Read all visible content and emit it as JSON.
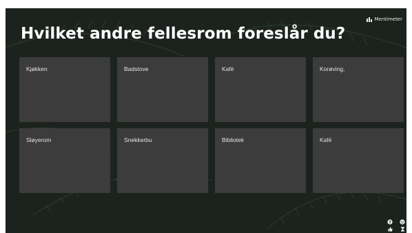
{
  "brand": {
    "name": "Mentimeter",
    "icon": "mentimeter-logo-icon"
  },
  "question": {
    "title": "Hvilket andre fellesrom foreslår du?"
  },
  "responses": [
    {
      "text": "Kjøkken"
    },
    {
      "text": "Badstove"
    },
    {
      "text": "Kafè"
    },
    {
      "text": "Korøving,"
    },
    {
      "text": "Sløyerom"
    },
    {
      "text": "Snekkerbu"
    },
    {
      "text": "Bibliotek"
    },
    {
      "text": "Kafé"
    }
  ],
  "controls": [
    {
      "icon": "help-icon"
    },
    {
      "icon": "reactions-icon"
    },
    {
      "icon": "thumbs-up-icon"
    },
    {
      "icon": "hourglass-icon"
    }
  ],
  "colors": {
    "background": "#1e2520",
    "card": "#3e3e3e",
    "text": "#ffffff"
  }
}
